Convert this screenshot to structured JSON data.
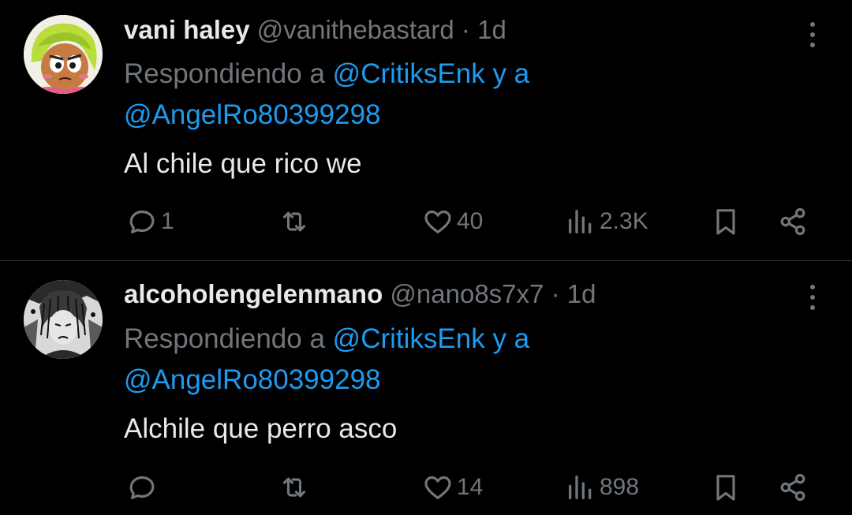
{
  "tweets": [
    {
      "display_name": "vani haley",
      "handle": "@vanithebastard",
      "separator": "·",
      "time": "1d",
      "replying_prefix": "Respondiendo a",
      "mention_1": "@CritiksEnk",
      "replying_join": "y a",
      "mention_2": "@AngelRo80399298",
      "text": "Al chile que rico we",
      "replies": "1",
      "retweets": "",
      "likes": "40",
      "views": "2.3K",
      "avatar_icon": "cartoon-girl-avatar"
    },
    {
      "display_name": "alcoholengelenmano",
      "handle": "@nano8s7x7",
      "separator": "·",
      "time": "1d",
      "replying_prefix": "Respondiendo a",
      "mention_1": "@CritiksEnk",
      "replying_join": "y a",
      "mention_2": "@AngelRo80399298",
      "text": "Alchile que perro asco",
      "replies": "",
      "retweets": "",
      "likes": "14",
      "views": "898",
      "avatar_icon": "manga-sketch-avatar"
    }
  ],
  "colors": {
    "background": "#000000",
    "text": "#e7e9ea",
    "secondary": "#71767b",
    "link": "#1d9bf0",
    "divider": "#2f3336"
  }
}
